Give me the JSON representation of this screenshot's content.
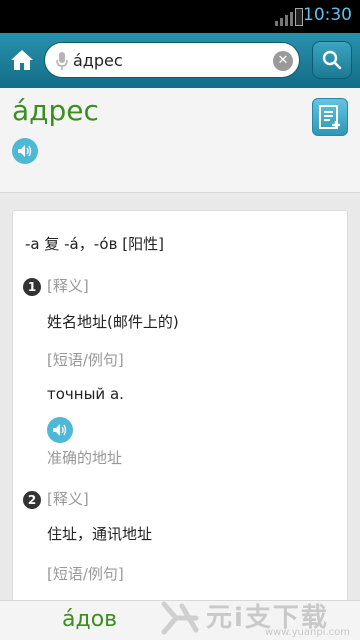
{
  "status_bar": {
    "time": "10:30"
  },
  "search": {
    "value": "áдрес"
  },
  "entry": {
    "headword": "áдрес",
    "grammar": "-а 复 -á，-óв [阳性]",
    "senses": [
      {
        "number": "1",
        "definition_label": "[释义]",
        "definition": "姓名地址(邮件上的)",
        "examples_label": "[短语/例句]",
        "example": "точный а.",
        "translation": "准确的地址"
      },
      {
        "number": "2",
        "definition_label": "[释义]",
        "definition": "住址，通讯地址",
        "examples_label": "[短语/例句]"
      }
    ]
  },
  "bottom_bar": {
    "previous_word": "áдов"
  },
  "watermark": {
    "text": "元i支下载",
    "url": "www.yuanpi.com"
  },
  "colors": {
    "toolbar": "#1b7f9b",
    "headword": "#3b8f1e",
    "speaker": "#4fb8d6",
    "time": "#5fc1ee"
  }
}
